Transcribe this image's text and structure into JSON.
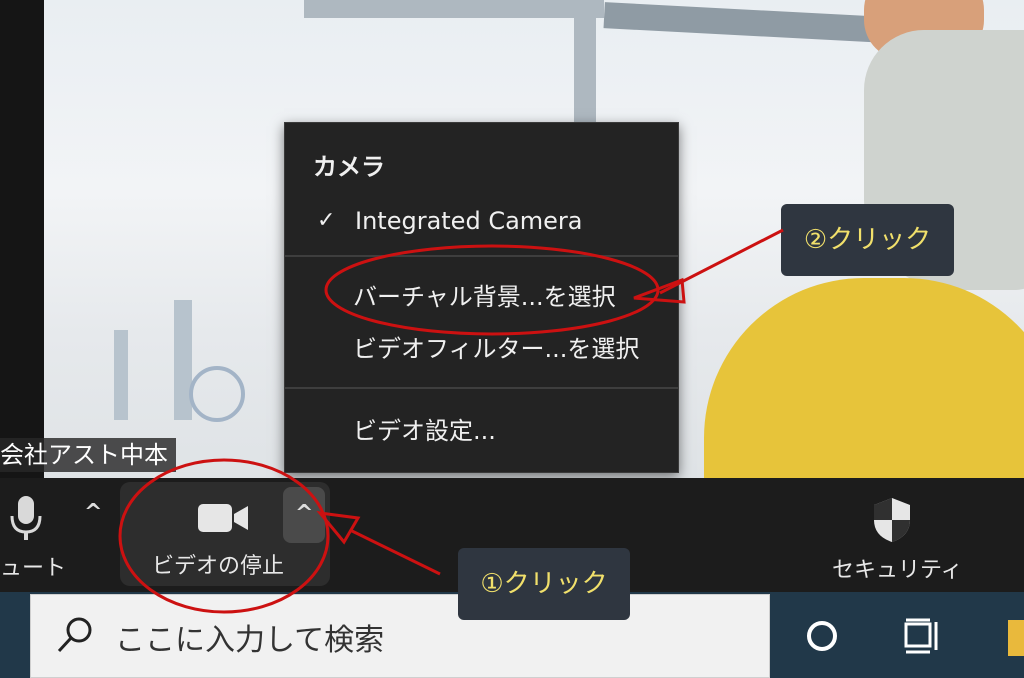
{
  "participant": {
    "name_tag": "会社アスト中本"
  },
  "camera_menu": {
    "heading": "カメラ",
    "items": [
      {
        "label": "Integrated Camera",
        "checked": true
      },
      {
        "label": "バーチャル背景...を選択"
      },
      {
        "label": "ビデオフィルター...を選択"
      },
      {
        "label": "ビデオ設定..."
      }
    ],
    "check_glyph": "✓"
  },
  "control_bar": {
    "mute_label": "ミュート",
    "mute_label_visible": "ュート",
    "video_label": "ビデオの停止",
    "security_label": "セキュリティ",
    "caret_glyph": "^"
  },
  "taskbar": {
    "search_placeholder": "ここに入力して検索"
  },
  "annotations": {
    "step1": "①クリック",
    "step2": "②クリック",
    "accent_color": "#cc1111",
    "callout_text_color": "#f1e06b"
  }
}
